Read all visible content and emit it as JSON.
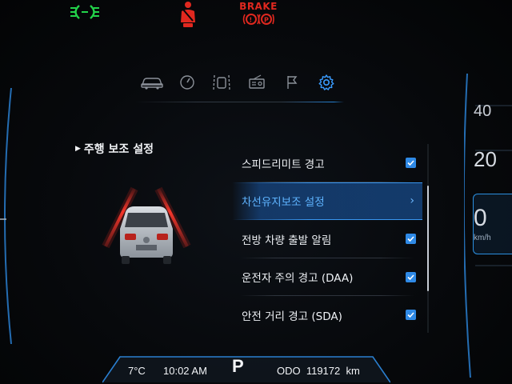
{
  "telltales": {
    "brake_label": "BRAKE"
  },
  "tabs": [
    {
      "icon": "car-icon",
      "active": false
    },
    {
      "icon": "speedometer-icon",
      "active": false
    },
    {
      "icon": "lane-assist-icon",
      "active": false
    },
    {
      "icon": "radio-icon",
      "active": false
    },
    {
      "icon": "flag-icon",
      "active": false
    },
    {
      "icon": "gear-icon",
      "active": true
    }
  ],
  "section": {
    "title": "주행 보조 설정"
  },
  "menu": {
    "items": [
      {
        "label": "스피드리미트 경고",
        "type": "checkbox",
        "checked": true
      },
      {
        "label": "차선유지보조 설정",
        "type": "submenu",
        "selected": true
      },
      {
        "label": "전방 차량 출발 알림",
        "type": "checkbox",
        "checked": true
      },
      {
        "label": "운전자 주의 경고 (DAA)",
        "type": "checkbox",
        "checked": true
      },
      {
        "label": "안전 거리 경고 (SDA)",
        "type": "checkbox",
        "checked": true
      }
    ]
  },
  "speed_gauge": {
    "tick_40": "40",
    "tick_20": "20",
    "current": "0",
    "unit": "km/h"
  },
  "status_bar": {
    "temperature": "7°C",
    "time": "10:02 AM",
    "gear": "P",
    "odometer": "ODO  119172  km"
  },
  "colors": {
    "accent": "#2f8ae6",
    "selected_text": "#5fb4ff",
    "warning_red": "#e0281f",
    "telltale_green": "#23d34a"
  }
}
